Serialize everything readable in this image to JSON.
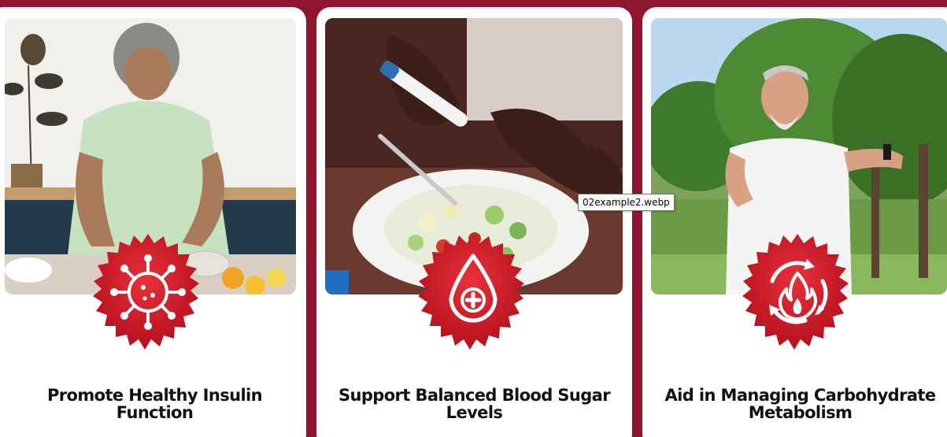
{
  "colors": {
    "page_background": "#8f1430",
    "card_background": "#ffffff",
    "badge_red": "#d81e2a",
    "title_text": "#111111"
  },
  "cards": [
    {
      "title": "Promote Healthy Insulin Function",
      "badge_icon": "virus-icon",
      "photo": "woman-preparing-food-photo"
    },
    {
      "title": "Support Balanced Blood Sugar Levels",
      "badge_icon": "blood-drop-plus-icon",
      "photo": "glucose-test-salad-photo"
    },
    {
      "title": "Aid in Managing Carbohydrate Metabolism",
      "badge_icon": "metabolism-flame-cycle-icon",
      "photo": "man-checking-watch-park-photo"
    }
  ],
  "tooltip": {
    "text": "02example2.webp"
  }
}
